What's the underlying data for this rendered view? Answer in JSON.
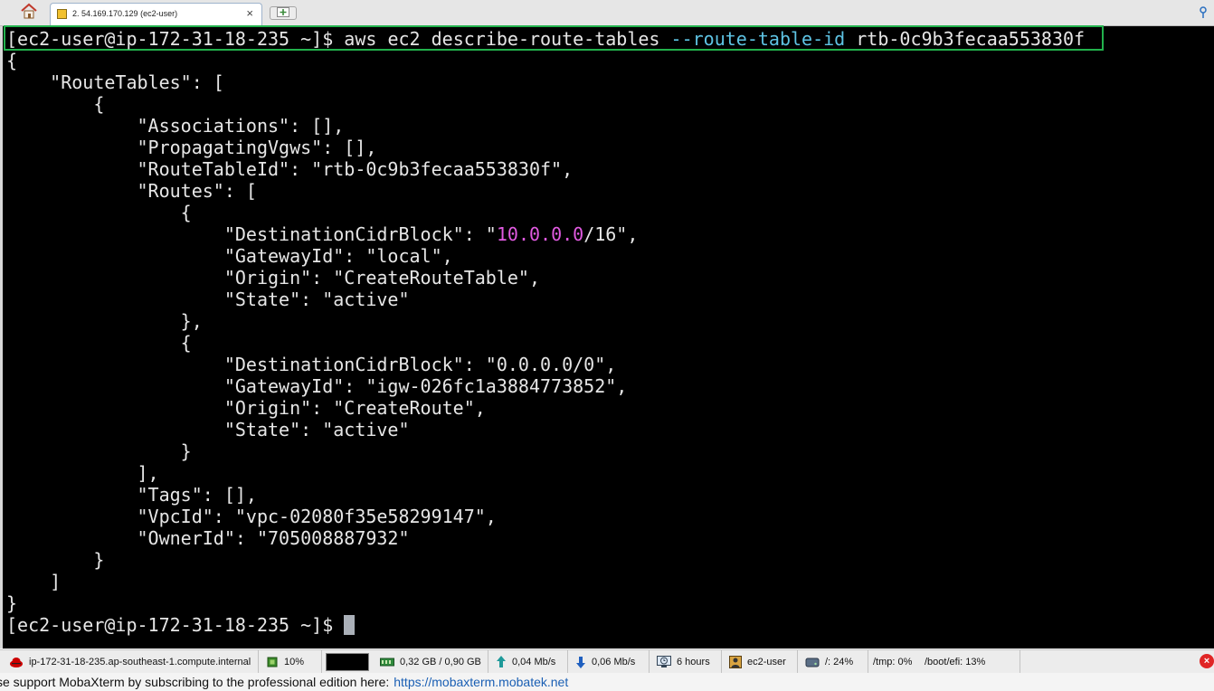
{
  "tabbar": {
    "tab_title": "2. 54.169.170.129 (ec2-user)",
    "close_glyph": "×",
    "icons": [
      "home-icon",
      "terminal-tab-icon",
      "new-tab-icon",
      "pin-icon"
    ]
  },
  "terminal": {
    "prompt": "[ec2-user@ip-172-31-18-235 ~]$",
    "command_main": "aws ec2 describe-route-tables",
    "command_flag": "--route-table-id",
    "command_arg": "rtb-0c9b3fecaa553830f",
    "output_lines": [
      "{",
      "    \"RouteTables\": [",
      "        {",
      "            \"Associations\": [],",
      "            \"PropagatingVgws\": [],",
      "            \"RouteTableId\": \"rtb-0c9b3fecaa553830f\",",
      "            \"Routes\": [",
      "                {"
    ],
    "cidr_prefix": "                    \"DestinationCidrBlock\": \"",
    "cidr_ip": "10.0.0.0",
    "cidr_suffix": "/16\",",
    "output_lines_2": [
      "                    \"GatewayId\": \"local\",",
      "                    \"Origin\": \"CreateRouteTable\",",
      "                    \"State\": \"active\"",
      "                },",
      "                {",
      "                    \"DestinationCidrBlock\": \"0.0.0.0/0\",",
      "                    \"GatewayId\": \"igw-026fc1a3884773852\",",
      "                    \"Origin\": \"CreateRoute\",",
      "                    \"State\": \"active\"",
      "                }",
      "            ],",
      "            \"Tags\": [],",
      "            \"VpcId\": \"vpc-02080f35e58299147\",",
      "            \"OwnerId\": \"705008887932\"",
      "        }",
      "    ]",
      "}"
    ],
    "final_prompt": "[ec2-user@ip-172-31-18-235 ~]$ "
  },
  "statusbar": {
    "hostname": "ip-172-31-18-235.ap-southeast-1.compute.internal",
    "cpu": "10%",
    "memory": "0,32 GB / 0,90 GB",
    "upload": "0,04 Mb/s",
    "download": "0,06 Mb/s",
    "uptime": "6 hours",
    "user": "ec2-user",
    "disk_root": "/: 24%",
    "disk_tmp": "/tmp: 0%",
    "disk_efi": "/boot/efi: 13%",
    "close_glyph": "×"
  },
  "footer": {
    "text": "se support MobaXterm by subscribing to the professional edition here:",
    "link": "https://mobaxterm.mobatek.net"
  }
}
